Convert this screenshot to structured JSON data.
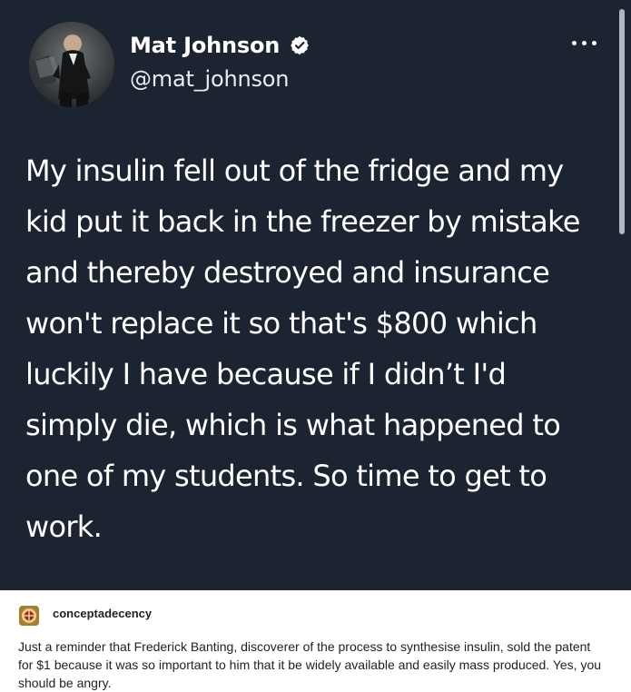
{
  "tweet": {
    "author_name": "Mat Johnson",
    "author_handle": "@mat_johnson",
    "verified_icon": "verified-badge-icon",
    "more_icon": "more-options-icon",
    "text": "My insulin fell out of the fridge and my kid put it back in the freezer by mistake and thereby destroyed and insurance won't replace it so that's $800 which luckily I have because if I didn’t  I'd simply die, which is what happened to one of my students. So time to get to work.",
    "colors": {
      "background": "#1b2430",
      "text": "#ffffff",
      "verified_badge": "#ffffff"
    }
  },
  "reblog": {
    "username": "conceptadecency",
    "text": "Just a reminder that Frederick Banting, discoverer of the process to synthesise insulin, sold the patent for $1 because it was so important to him that it be widely available and easily mass produced. Yes, you should be angry.",
    "colors": {
      "background": "#ffffff",
      "text": "#222222"
    }
  }
}
